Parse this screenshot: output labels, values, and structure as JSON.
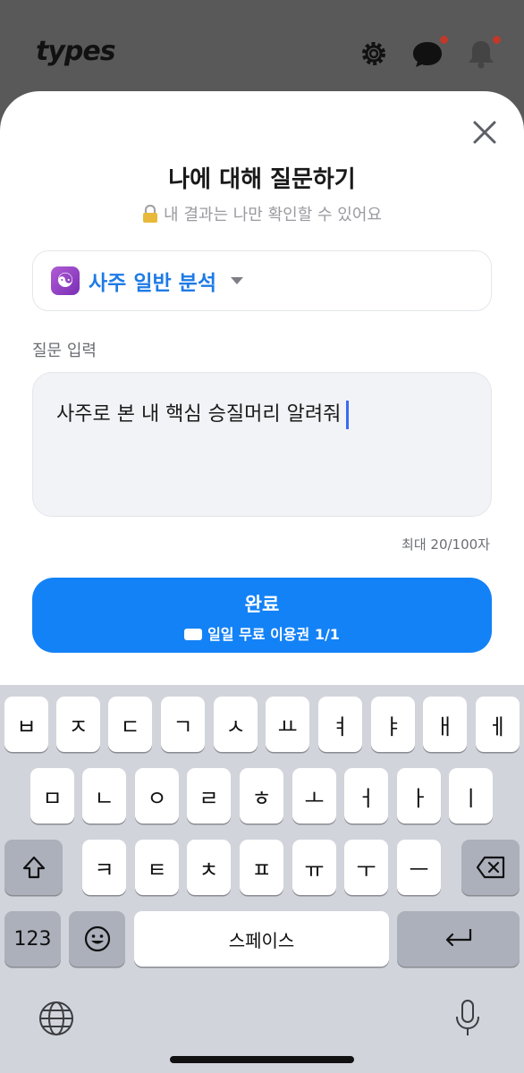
{
  "header": {
    "logo": "types",
    "icons": [
      "gear-icon",
      "chat-icon",
      "bell-icon"
    ]
  },
  "sheet": {
    "title": "나에 대해 질문하기",
    "subtitle": "내 결과는 나만 확인할 수 있어요",
    "selector": {
      "label": "사주 일반 분석",
      "icon": "yin-yang-icon"
    },
    "input_label": "질문 입력",
    "input_value": "사주로 본 내 핵심 승질머리 알려줘",
    "counter": "최대 20/100자",
    "done_button": {
      "label": "완료",
      "sub": "일일 무료 이용권 1/1"
    }
  },
  "keyboard": {
    "row1": [
      "ㅂ",
      "ㅈ",
      "ㄷ",
      "ㄱ",
      "ㅅ",
      "ㅛ",
      "ㅕ",
      "ㅑ",
      "ㅐ",
      "ㅔ"
    ],
    "row2": [
      "ㅁ",
      "ㄴ",
      "ㅇ",
      "ㄹ",
      "ㅎ",
      "ㅗ",
      "ㅓ",
      "ㅏ",
      "ㅣ"
    ],
    "row3": [
      "ㅋ",
      "ㅌ",
      "ㅊ",
      "ㅍ",
      "ㅠ",
      "ㅜ",
      "ㅡ"
    ],
    "numbers_key": "123",
    "space_key": "스페이스"
  },
  "colors": {
    "accent": "#1382f6",
    "selector_text": "#1e7be6",
    "notification_dot": "#c0392b"
  }
}
